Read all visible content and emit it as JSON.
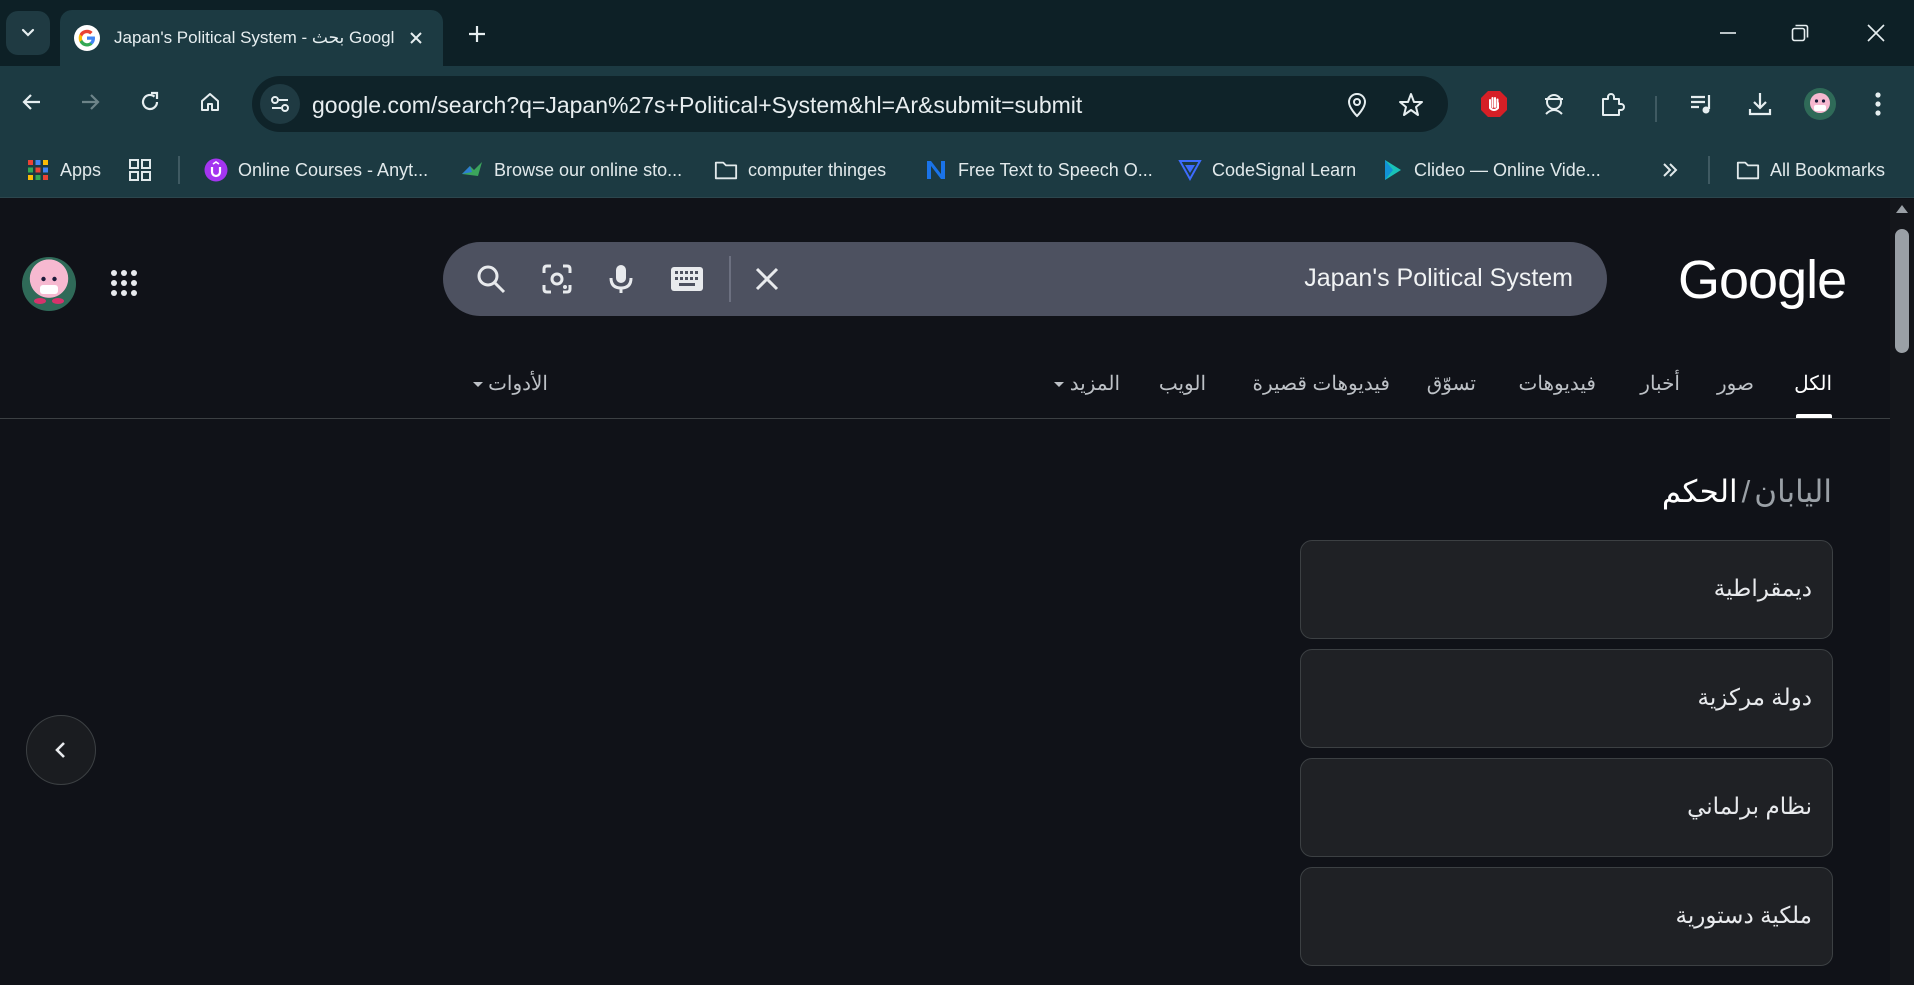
{
  "browser": {
    "tab_title": "Japan's Political System - بحث Google",
    "url": "google.com/search?q=Japan%27s+Political+System&hl=Ar&submit=submit"
  },
  "bookmarks": [
    {
      "label": "Apps",
      "icon": "apps-grid-icon"
    },
    {
      "label": "Online Courses - Anyt...",
      "icon": "udemy-icon"
    },
    {
      "label": "Browse our online sto...",
      "icon": "bird-icon"
    },
    {
      "label": "computer thinges",
      "icon": "folder-icon"
    },
    {
      "label": "Free Text to Speech O...",
      "icon": "n-logo-icon"
    },
    {
      "label": "CodeSignal Learn",
      "icon": "codesignal-icon"
    },
    {
      "label": "Clideo — Online Vide...",
      "icon": "play-icon"
    },
    {
      "label": "All Bookmarks",
      "icon": "folder-icon"
    }
  ],
  "search": {
    "query": "Japan's Political System",
    "logo": "Google"
  },
  "search_tabs": [
    {
      "label": "الكل",
      "active": true
    },
    {
      "label": "صور"
    },
    {
      "label": "أخبار"
    },
    {
      "label": "فيديوهات"
    },
    {
      "label": "تسوّق"
    },
    {
      "label": "فيديوهات قصيرة"
    },
    {
      "label": "الويب"
    },
    {
      "label": "المزيد"
    },
    {
      "label": "الأدوات"
    }
  ],
  "breadcrumb": {
    "parent": "اليابان",
    "separator": "/",
    "current": "الحكم"
  },
  "cards": [
    {
      "label": "ديمقراطية"
    },
    {
      "label": "دولة مركزية"
    },
    {
      "label": "نظام برلماني"
    },
    {
      "label": "ملكية دستورية"
    }
  ],
  "colors": {
    "tabstrip": "#0d2026",
    "toolbar": "#1c3a42",
    "page_bg": "#101218",
    "searchbox": "#4d5160"
  }
}
